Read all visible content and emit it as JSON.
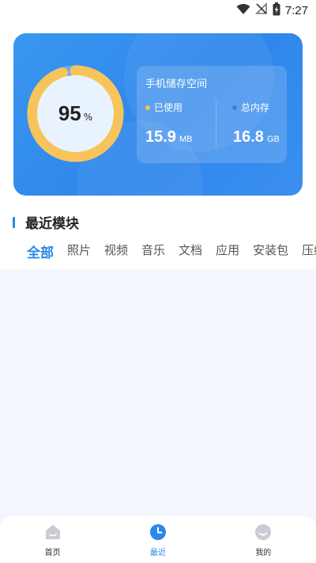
{
  "status_bar": {
    "time": "7:27",
    "icons": [
      "wifi-icon",
      "no-signal-icon",
      "battery-charging-icon"
    ]
  },
  "storage_card": {
    "used_percent": 95,
    "percent_unit": "%",
    "title": "手机储存空间",
    "used_label": "已使用",
    "used_value": "15.9",
    "used_unit": "MB",
    "total_label": "总内存",
    "total_value": "16.8",
    "total_unit": "GB",
    "colors": {
      "ring": "#f7c45c",
      "used_dot": "#f7c45c",
      "total_dot": "#2b87ea",
      "card": "#3590ee"
    }
  },
  "section": {
    "title": "最近模块"
  },
  "tabs": [
    {
      "label": "全部",
      "active": true
    },
    {
      "label": "照片",
      "active": false
    },
    {
      "label": "视频",
      "active": false
    },
    {
      "label": "音乐",
      "active": false
    },
    {
      "label": "文档",
      "active": false
    },
    {
      "label": "应用",
      "active": false
    },
    {
      "label": "安装包",
      "active": false
    },
    {
      "label": "压缩",
      "active": false
    }
  ],
  "bottom_nav": [
    {
      "label": "首页",
      "icon": "home-icon",
      "active": false
    },
    {
      "label": "最近",
      "icon": "clock-icon",
      "active": true
    },
    {
      "label": "我的",
      "icon": "profile-icon",
      "active": false
    }
  ]
}
